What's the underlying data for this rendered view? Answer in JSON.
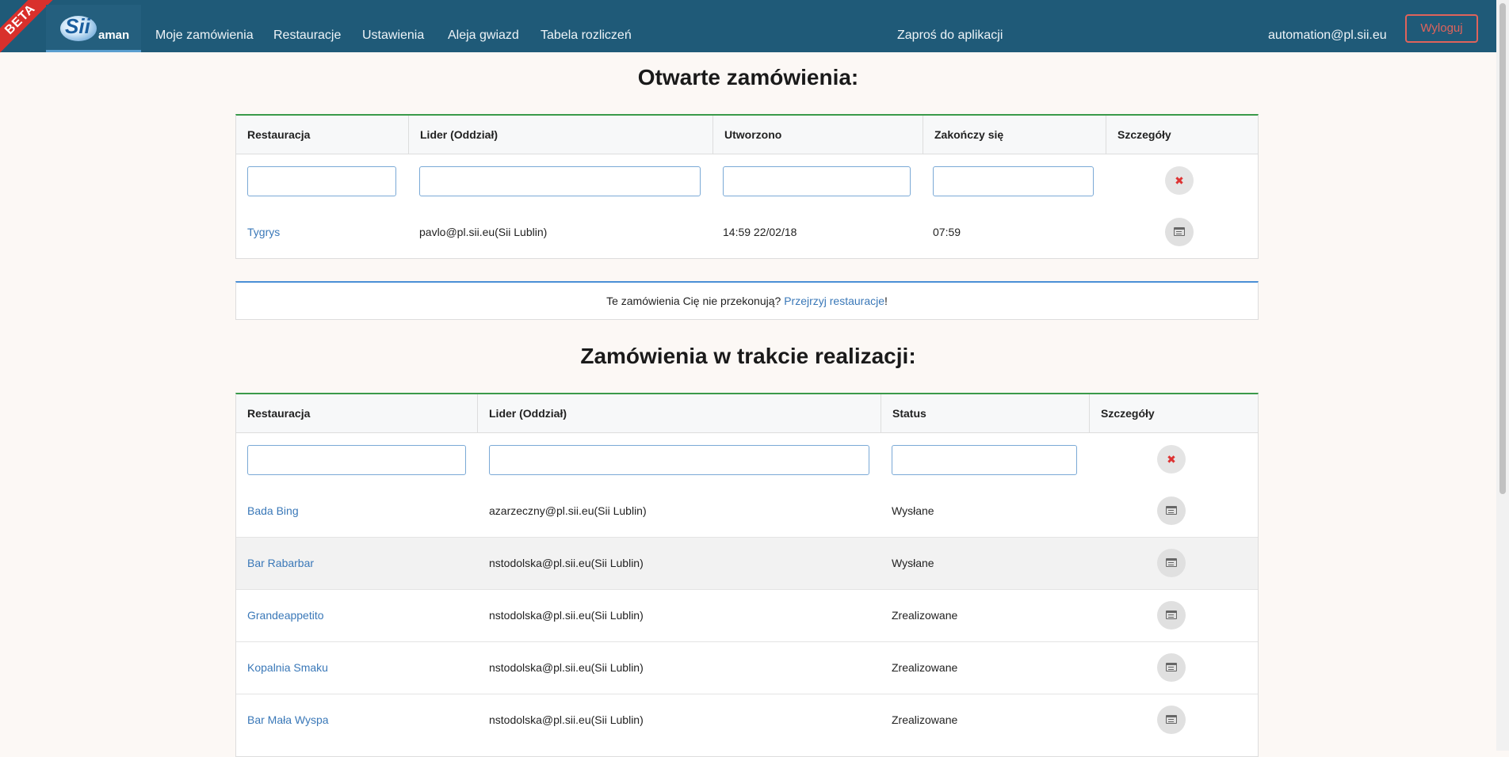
{
  "beta_badge": "BETA",
  "brand": {
    "logo_text": "Sii",
    "suffix": "aman"
  },
  "nav": {
    "links": [
      "Moje zamówienia",
      "Restauracje",
      "Ustawienia",
      "Aleja gwiazd",
      "Tabela rozliczeń"
    ],
    "invite": "Zaproś do aplikacji",
    "user_email": "automation@pl.sii.eu",
    "logout": "Wyloguj"
  },
  "open_orders": {
    "title": "Otwarte zamówienia:",
    "headers": [
      "Restauracja",
      "Lider (Oddział)",
      "Utworzono",
      "Zakończy się",
      "Szczegóły"
    ],
    "rows": [
      {
        "restaurant": "Tygrys",
        "leader": "pavlo@pl.sii.eu(Sii Lublin)",
        "created": "14:59 22/02/18",
        "ends": "07:59"
      }
    ]
  },
  "info": {
    "text": "Te zamówienia Cię nie przekonują? ",
    "link": "Przejrzyj restauracje",
    "suffix": "!"
  },
  "in_progress": {
    "title": "Zamówienia w trakcie realizacji:",
    "headers": [
      "Restauracja",
      "Lider (Oddział)",
      "Status",
      "Szczegóły"
    ],
    "rows": [
      {
        "restaurant": "Bada Bing",
        "leader": "azarzeczny@pl.sii.eu(Sii Lublin)",
        "status": "Wysłane"
      },
      {
        "restaurant": "Bar Rabarbar",
        "leader": "nstodolska@pl.sii.eu(Sii Lublin)",
        "status": "Wysłane"
      },
      {
        "restaurant": "Grandeappetito",
        "leader": "nstodolska@pl.sii.eu(Sii Lublin)",
        "status": "Zrealizowane"
      },
      {
        "restaurant": "Kopalnia Smaku",
        "leader": "nstodolska@pl.sii.eu(Sii Lublin)",
        "status": "Zrealizowane"
      },
      {
        "restaurant": "Bar Mała Wyspa",
        "leader": "nstodolska@pl.sii.eu(Sii Lublin)",
        "status": "Zrealizowane"
      }
    ]
  },
  "icons": {
    "clear": "x-clear-icon",
    "details": "details-icon"
  },
  "colors": {
    "navbar": "#1f5a78",
    "beta": "#d9302c",
    "logout": "#e0635b",
    "link": "#3a78b8",
    "table_accent": "#3a9a4a",
    "info_accent": "#4a8fd6"
  }
}
